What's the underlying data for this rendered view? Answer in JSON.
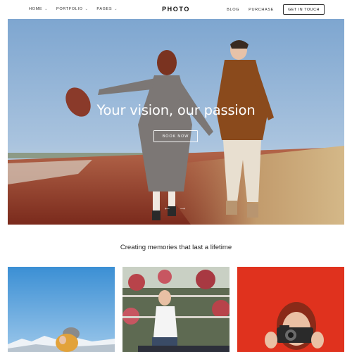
{
  "header": {
    "logo": "PHOTO",
    "nav_left": [
      {
        "label": "HOME",
        "icon": "chevron-down-icon"
      },
      {
        "label": "PORTFOLIO",
        "icon": "chevron-down-icon"
      },
      {
        "label": "PAGES",
        "icon": "chevron-down-icon"
      }
    ],
    "nav_right": [
      {
        "label": "BLOG"
      },
      {
        "label": "PURCHASE"
      }
    ],
    "cta_label": "GET IN TOUCH"
  },
  "hero": {
    "title": "Your vision, our passion",
    "button_label": "BOOK NOW",
    "prev_icon": "arrow-left-icon",
    "next_icon": "arrow-right-icon"
  },
  "tagline": "Creating memories that last a lifetime",
  "gallery": [
    {
      "name": "mountain-portrait-photo"
    },
    {
      "name": "flower-garden-photo"
    },
    {
      "name": "camera-portrait-photo"
    }
  ],
  "colors": {
    "sky": "#8fb3d6",
    "field_red": "#9a3a28",
    "grass": "#b89a6a",
    "accent_red": "#e0321e"
  }
}
